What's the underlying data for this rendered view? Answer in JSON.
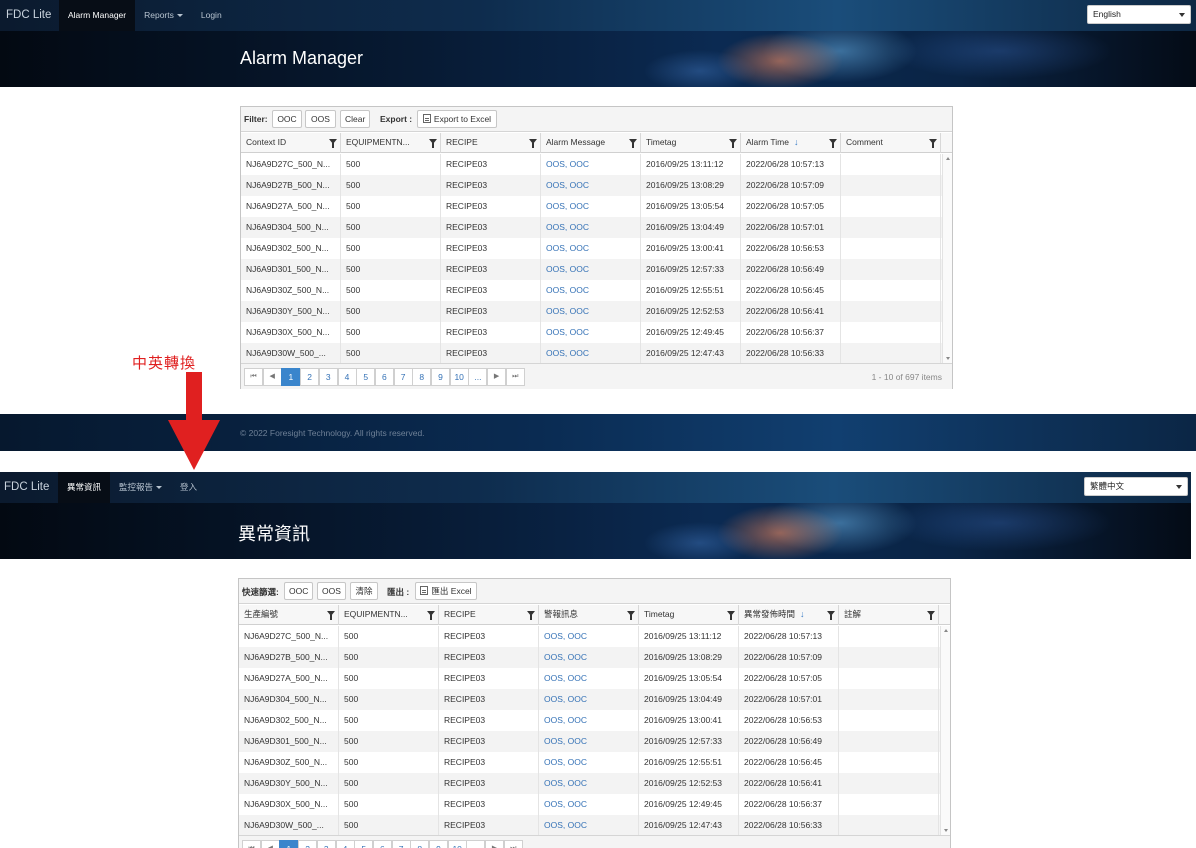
{
  "annotation": {
    "label": "中英轉換"
  },
  "screens": {
    "en": {
      "brand": "FDC Lite",
      "nav": [
        {
          "label": "Alarm Manager",
          "active": true
        },
        {
          "label": "Reports",
          "dropdown": true
        },
        {
          "label": "Login"
        }
      ],
      "language": "English",
      "heading": "Alarm Manager",
      "toolbar": {
        "filter_label": "Filter:",
        "ooc_label": "OOC",
        "oos_label": "OOS",
        "clear_label": "Clear",
        "export_label": "Export :",
        "export_button_label": "Export to Excel"
      },
      "columns": [
        "Context ID",
        "EQUIPMENTN...",
        "RECIPE",
        "Alarm Message",
        "Timetag",
        "Alarm Time",
        "Comment"
      ],
      "pager_info": "1 - 10 of 697 items",
      "footer": "© 2022 Foresight Technology. All rights reserved."
    },
    "zh": {
      "brand": "FDC Lite",
      "nav": [
        {
          "label": "異常資訊",
          "active": true
        },
        {
          "label": "監控報告",
          "dropdown": true
        },
        {
          "label": "登入"
        }
      ],
      "language": "繁體中文",
      "heading": "異常資訊",
      "toolbar": {
        "filter_label": "快速篩選:",
        "ooc_label": "OOC",
        "oos_label": "OOS",
        "clear_label": "清除",
        "export_label": "匯出 :",
        "export_button_label": "匯出 Excel"
      },
      "columns": [
        "生產編號",
        "EQUIPMENTN...",
        "RECIPE",
        "警報訊息",
        "Timetag",
        "異常發佈時間",
        "註解"
      ]
    }
  },
  "rows": [
    {
      "context_id": "NJ6A9D27C_500_N...",
      "equipment": "500",
      "recipe": "RECIPE03",
      "alarm_message": "OOS, OOC",
      "timetag": "2016/09/25 13:11:12",
      "alarm_time": "2022/06/28 10:57:13",
      "comment": ""
    },
    {
      "context_id": "NJ6A9D27B_500_N...",
      "equipment": "500",
      "recipe": "RECIPE03",
      "alarm_message": "OOS, OOC",
      "timetag": "2016/09/25 13:08:29",
      "alarm_time": "2022/06/28 10:57:09",
      "comment": ""
    },
    {
      "context_id": "NJ6A9D27A_500_N...",
      "equipment": "500",
      "recipe": "RECIPE03",
      "alarm_message": "OOS, OOC",
      "timetag": "2016/09/25 13:05:54",
      "alarm_time": "2022/06/28 10:57:05",
      "comment": ""
    },
    {
      "context_id": "NJ6A9D304_500_N...",
      "equipment": "500",
      "recipe": "RECIPE03",
      "alarm_message": "OOS, OOC",
      "timetag": "2016/09/25 13:04:49",
      "alarm_time": "2022/06/28 10:57:01",
      "comment": ""
    },
    {
      "context_id": "NJ6A9D302_500_N...",
      "equipment": "500",
      "recipe": "RECIPE03",
      "alarm_message": "OOS, OOC",
      "timetag": "2016/09/25 13:00:41",
      "alarm_time": "2022/06/28 10:56:53",
      "comment": ""
    },
    {
      "context_id": "NJ6A9D301_500_N...",
      "equipment": "500",
      "recipe": "RECIPE03",
      "alarm_message": "OOS, OOC",
      "timetag": "2016/09/25 12:57:33",
      "alarm_time": "2022/06/28 10:56:49",
      "comment": ""
    },
    {
      "context_id": "NJ6A9D30Z_500_N...",
      "equipment": "500",
      "recipe": "RECIPE03",
      "alarm_message": "OOS, OOC",
      "timetag": "2016/09/25 12:55:51",
      "alarm_time": "2022/06/28 10:56:45",
      "comment": ""
    },
    {
      "context_id": "NJ6A9D30Y_500_N...",
      "equipment": "500",
      "recipe": "RECIPE03",
      "alarm_message": "OOS, OOC",
      "timetag": "2016/09/25 12:52:53",
      "alarm_time": "2022/06/28 10:56:41",
      "comment": ""
    },
    {
      "context_id": "NJ6A9D30X_500_N...",
      "equipment": "500",
      "recipe": "RECIPE03",
      "alarm_message": "OOS, OOC",
      "timetag": "2016/09/25 12:49:45",
      "alarm_time": "2022/06/28 10:56:37",
      "comment": ""
    },
    {
      "context_id": "NJ6A9D30W_500_...",
      "equipment": "500",
      "recipe": "RECIPE03",
      "alarm_message": "OOS, OOC",
      "timetag": "2016/09/25 12:47:43",
      "alarm_time": "2022/06/28 10:56:33",
      "comment": ""
    }
  ],
  "pager": {
    "first": "⏮",
    "prev": "◀",
    "pages": [
      "1",
      "2",
      "3",
      "4",
      "5",
      "6",
      "7",
      "8",
      "9",
      "10",
      "..."
    ],
    "current": "1",
    "next": "▶",
    "last": "⏭"
  },
  "colors": {
    "link": "#3572b6",
    "pager_current": "#3a85cc",
    "annotation": "#e02020"
  },
  "icons": {
    "filter": "filter-icon",
    "sort": "sort-descending-icon",
    "excel": "excel-file-icon"
  }
}
